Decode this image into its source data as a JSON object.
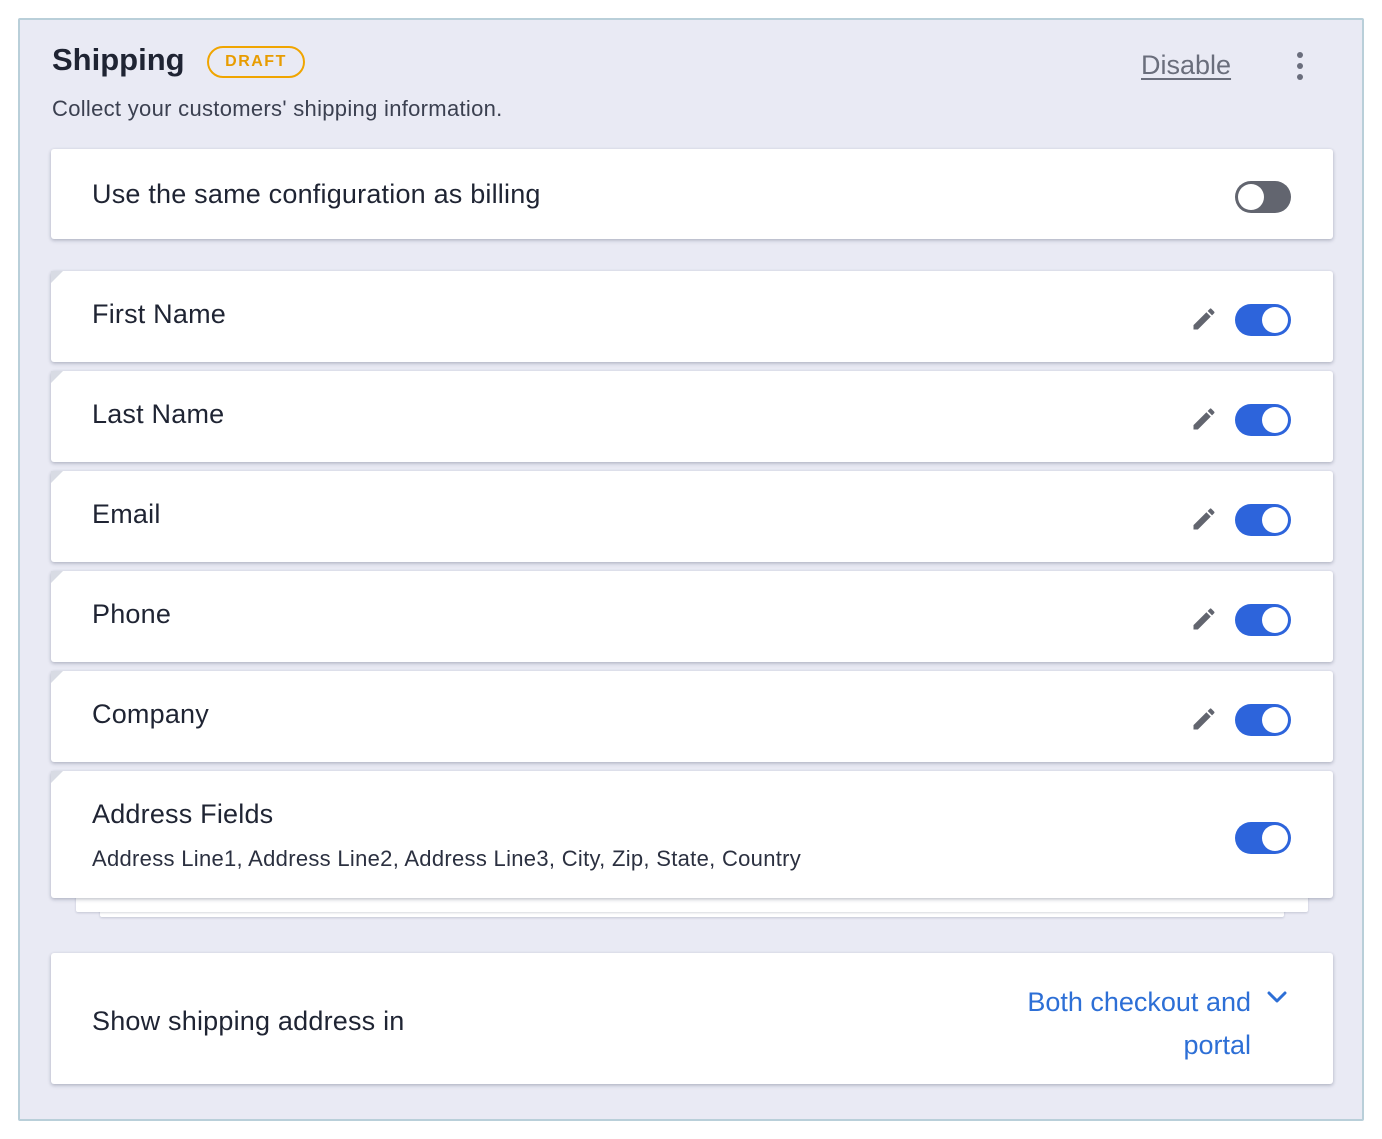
{
  "header": {
    "title": "Shipping",
    "badge": "DRAFT",
    "subtitle": "Collect your customers' shipping information.",
    "disable_label": "Disable",
    "more_icon": "more-vertical-icon"
  },
  "same_as_billing": {
    "label": "Use the same configuration as billing",
    "enabled": false
  },
  "fields": [
    {
      "label": "First Name",
      "editable": true,
      "enabled": true
    },
    {
      "label": "Last Name",
      "editable": true,
      "enabled": true
    },
    {
      "label": "Email",
      "editable": true,
      "enabled": true
    },
    {
      "label": "Phone",
      "editable": true,
      "enabled": true
    },
    {
      "label": "Company",
      "editable": true,
      "enabled": true
    }
  ],
  "address": {
    "label": "Address Fields",
    "sub_label": "Address Line1, Address Line2, Address Line3, City, Zip, State, Country",
    "enabled": true
  },
  "show_address": {
    "label": "Show shipping address in",
    "value_line1": "Both checkout and",
    "value_line2": "portal"
  },
  "colors": {
    "accent": "#2d64db",
    "link": "#2d6fd6",
    "badge": "#f0a500",
    "panel_bg": "#e9eaf4"
  }
}
